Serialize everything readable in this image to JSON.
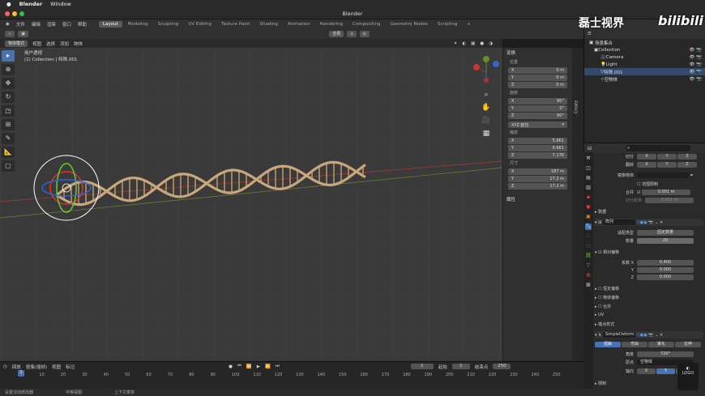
{
  "mac": {
    "apple": "",
    "app": "Blender",
    "window": "Window"
  },
  "title": "Blender",
  "menu": [
    "文件",
    "编辑",
    "渲染",
    "窗口",
    "帮助"
  ],
  "workspaces": [
    "Layout",
    "Modeling",
    "Sculpting",
    "UV Editing",
    "Texture Paint",
    "Shading",
    "Animation",
    "Rendering",
    "Compositing",
    "Geometry Nodes",
    "Scripting"
  ],
  "header": {
    "mode": "物体模式",
    "view": "视图",
    "select": "选择",
    "add": "添加",
    "object": "物体",
    "orient": "全局"
  },
  "viewport": {
    "view_name": "用户透视",
    "collection_info": "(1) Collection | 特殊.001"
  },
  "npanel": {
    "transform": "变换",
    "location": "位置",
    "loc": [
      {
        "axis": "X",
        "val": "0 m"
      },
      {
        "axis": "Y",
        "val": "0 m"
      },
      {
        "axis": "Z",
        "val": "0 m"
      }
    ],
    "rotation": "旋转",
    "rot": [
      {
        "axis": "X",
        "val": "90°"
      },
      {
        "axis": "Y",
        "val": "0°"
      },
      {
        "axis": "Z",
        "val": "90°"
      }
    ],
    "rot_mode": "XYZ 欧拉",
    "scale": "缩放",
    "scl": [
      {
        "axis": "X",
        "val": "5.661"
      },
      {
        "axis": "Y",
        "val": "0.661"
      },
      {
        "axis": "Z",
        "val": "7.176"
      }
    ],
    "dimensions": "尺寸",
    "dim": [
      {
        "axis": "X",
        "val": "187 m"
      },
      {
        "axis": "Y",
        "val": "17.2 m"
      },
      {
        "axis": "Z",
        "val": "17.2 m"
      }
    ],
    "properties": "属性",
    "tab": "Create"
  },
  "outliner": {
    "scene": "场景集合",
    "items": [
      {
        "name": "Collection",
        "icon": "collection-icon"
      },
      {
        "name": "Camera",
        "icon": "camera-icon"
      },
      {
        "name": "Light",
        "icon": "light-icon"
      },
      {
        "name": "特殊.001",
        "icon": "mesh-icon"
      },
      {
        "name": "空物体",
        "icon": "empty-icon"
      }
    ]
  },
  "props": {
    "search_placeholder": "",
    "mirror_axes": "切分",
    "bisect": "翻转",
    "x": "X",
    "y": "Y",
    "z": "Z",
    "mirror_obj": "镜像物体",
    "clipping": "范围限制",
    "merge": "合并",
    "merge_val": "0.001 m",
    "bisect_dist": "切分距离",
    "bisect_val": "0.001 m",
    "data": "数据",
    "array_name": "阵列",
    "fit_type_label": "适配类型",
    "fit_type": "固定数量",
    "count_label": "数量",
    "count": "20",
    "relative_offset": "相对偏移",
    "factor_x_label": "系数 X",
    "factor_x": "0.400",
    "factor_y": "0.000",
    "factor_z": "0.000",
    "const_offset": "恒定偏移",
    "obj_offset": "物体偏移",
    "merge2": "合并",
    "uv": "UV",
    "caps": "端点样式",
    "deform_name": "SimpleDeform",
    "deform_modes": [
      "扭曲",
      "弯曲",
      "锥化",
      "拉伸"
    ],
    "angle_label": "角度",
    "angle": "720°",
    "origin_label": "原点",
    "origin": "空物体",
    "axis_label": "轴向",
    "limits": "限制"
  },
  "timeline": {
    "menu": [
      "回放",
      "抠像(插帧)",
      "视图",
      "标记"
    ],
    "current": "1",
    "start_label": "起始",
    "start": "1",
    "end_label": "结束点",
    "end": "250",
    "ticks": [
      "1",
      "10",
      "20",
      "30",
      "40",
      "50",
      "60",
      "70",
      "80",
      "90",
      "100",
      "110",
      "120",
      "130",
      "140",
      "150",
      "160",
      "170",
      "180",
      "190",
      "200",
      "210",
      "220",
      "230",
      "240",
      "250"
    ]
  },
  "status": [
    "设置活动修改器",
    "平移视图",
    "上下文菜单"
  ],
  "watermark": {
    "text": "磊士视界",
    "brand": "bilibili"
  },
  "colors": {
    "accent": "#4772b3",
    "grid": "#3a3a3a",
    "helix": "#c9a77c",
    "xaxis": "#8e3a3a",
    "yaxis": "#6a8a2e"
  }
}
